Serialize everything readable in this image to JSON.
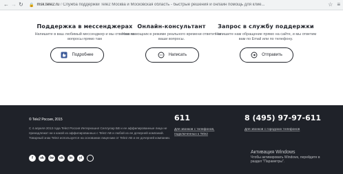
{
  "browser": {
    "host": "msk.tele2.ru",
    "separator": "/",
    "page_title": "Служба поддержки Tele2 Москва и Московская область - быстрые решения и онлайн помощь для клие..."
  },
  "support": {
    "messengers": {
      "title": "Поддержка в мессенджерах",
      "text": "Напишите в ваш любимый мессенджер и мы ответим на вопросы прямо там",
      "button": "Подробнее"
    },
    "consultant": {
      "title": "Онлайн-консультант",
      "text": "Наш помощник в режиме реального времени ответит на ваши вопросы.",
      "button": "Написать"
    },
    "request": {
      "title": "Запрос в службу поддержки",
      "text": "Напишите нам обращение прямо на сайте, и мы ответим вам по Email или по телефону.",
      "button": "Отправить"
    }
  },
  "footer": {
    "copyright": "© Tele2 Россия, 2015",
    "legal": "С 4 апреля 2013 года Tele2 Россия Интернэшнл Селлулар БВ и ее аффилированные лица не принадлежат ни к какой из аффилированных с Tele2 AB и любой из ее дочерней компаний. Товарный знак Tele2 используется на основании лицензии от Tele2 AB и ее дочерней компании.",
    "short_number": "611",
    "short_caption": "Для звонков с телефонов, подключенных к Tele2",
    "long_number": "8 (495) 97-97-611",
    "long_caption": "Для звонков с городских телефонов",
    "social_letters": [
      "f",
      "vk",
      "tw",
      "ok",
      "in",
      "yt",
      "◑"
    ]
  },
  "watermark": {
    "title": "Активация Windows",
    "line1": "Чтобы активировать Windows, перейдите в",
    "line2": "раздел \"Параметры\"."
  }
}
